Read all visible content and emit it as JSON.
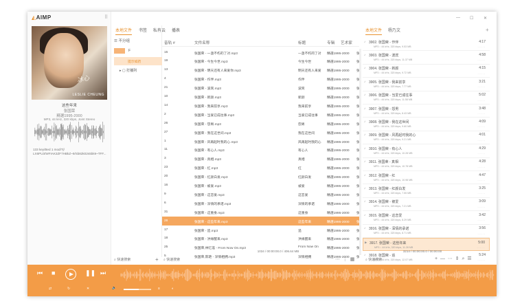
{
  "app": {
    "title": "AIMP"
  },
  "window": {
    "controls": [
      "—",
      "☐",
      "✕"
    ]
  },
  "track_info": {
    "title": "这些年来",
    "artist": "张国荣",
    "album": "精選1995-2000",
    "format": "MP3, 44 kHz, 320 kbps, Joint Stereo",
    "hash_line1": "133 key/Bed 1 mod/?|/",
    "hash_line2": "LX6PU3/WFIAK3ZF7HBkZ~9/Sb82k02s5bk9~TFF..."
  },
  "cover": {
    "signature": "冰心",
    "label": "LESLIE CHEUNG"
  },
  "library": {
    "tabs": [
      "本地文件",
      "书签",
      "私有云",
      "播表"
    ],
    "group_label": "不分组",
    "tree": [
      "F",
      "提示如药",
      "打播列"
    ],
    "search_placeholder": "快速搜索"
  },
  "file_list": {
    "columns": [
      "音轨 #",
      "文件名称",
      "标题",
      "专辑",
      "艺术家"
    ],
    "rows": [
      {
        "track": "15",
        "file": "张国荣 - 一盏不朽的了对.mp3",
        "title": "一盏不朽的了对",
        "album": "精選1995-2000",
        "artist": "张国荣"
      },
      {
        "track": "19",
        "file": "张国荣 - 今生今世.mp3",
        "title": "今生今世",
        "album": "精選1995-2000",
        "artist": "张国荣"
      },
      {
        "track": "13",
        "file": "张国荣 - 明天还有人来爱你.mp3",
        "title": "明天还有人来爱",
        "album": "精選1995-2000",
        "artist": "张国荣"
      },
      {
        "track": "4",
        "file": "张国荣 - 作伴.mp3",
        "title": "作伴",
        "album": "精選1995-2000",
        "artist": "张国荣"
      },
      {
        "track": "21",
        "file": "张国荣 - 波宾.mp3",
        "title": "波宾",
        "album": "精選1995-2000",
        "artist": "张国荣"
      },
      {
        "track": "10",
        "file": "张国荣 - 新颜.mp3",
        "title": "新颜",
        "album": "精選1995-2000",
        "artist": "张国荣"
      },
      {
        "track": "14",
        "file": "张国荣 - 我来前享.mp3",
        "title": "我来前享",
        "album": "精選1995-2000",
        "artist": "张国荣"
      },
      {
        "track": "2",
        "file": "张国荣 - 当爱已成往事.mp3",
        "title": "当爱已成往事",
        "album": "精選1995-2000",
        "artist": "张国荣"
      },
      {
        "track": "26",
        "file": "张国荣 - 怨男.mp3",
        "title": "怨男",
        "album": "精選1995-2000",
        "artist": "张国荣"
      },
      {
        "track": "27",
        "file": "张国荣 - 我在这世间.mp3",
        "title": "我在这世间",
        "album": "精選1995-2000",
        "artist": "张国荣"
      },
      {
        "track": "1",
        "file": "张国荣 - 风再起时我的心.mp3",
        "title": "风再起时我的心",
        "album": "精選1995-2000",
        "artist": "张国荣"
      },
      {
        "track": "11",
        "file": "张国荣 - 有心人.mp3",
        "title": "有心人",
        "album": "精選1995-2000",
        "artist": "张国荣"
      },
      {
        "track": "3",
        "file": "张国荣 - 真相.mp3",
        "title": "真相",
        "album": "精選1995-2000",
        "artist": "张国荣"
      },
      {
        "track": "23",
        "file": "张国荣 - 红.mp3",
        "title": "红",
        "album": "精選1995-2000",
        "artist": "张国荣"
      },
      {
        "track": "20",
        "file": "张国荣 - 红颜白发.mp3",
        "title": "红颜白发",
        "album": "精選1995-2000",
        "artist": "张国荣"
      },
      {
        "track": "16",
        "file": "张国荣 - 被爱.mp3",
        "title": "被爱",
        "album": "精選1995-2000",
        "artist": "张国荣"
      },
      {
        "track": "9",
        "file": "张国荣 - 这恋爱.mp3",
        "title": "这恋爱",
        "album": "精選1995-2000",
        "artist": "张国荣"
      },
      {
        "track": "6",
        "file": "张国荣 - 深情的承诺.mp3",
        "title": "深情的承诺",
        "album": "精選1995-2000",
        "artist": "张国荣"
      },
      {
        "track": "31",
        "file": "张国荣 - 这重身.mp3",
        "title": "这重身",
        "album": "精選1995-2000",
        "artist": "张国荣"
      },
      {
        "track": "28",
        "file": "张国荣 - 这些年来.mp3",
        "title": "这些年来",
        "album": "精選1995-2000",
        "artist": "张国荣",
        "selected": true
      },
      {
        "track": "17",
        "file": "张国荣 - 追.mp3",
        "title": "追",
        "album": "精選1995-2000",
        "artist": "张国荣"
      },
      {
        "track": "18",
        "file": "张国荣 - 洪缘醒来.mp3",
        "title": "洪缘醒来",
        "album": "精選1995-2000",
        "artist": "张国荣"
      },
      {
        "track": "25",
        "file": "张国荣,林忆莲 - From Now On.mp3",
        "title": "From Now On",
        "album": "精選1995-2000",
        "artist": "张国荣,林忆"
      },
      {
        "track": "5",
        "file": "张国荣,陈艳 - 深情相拥.mp3",
        "title": "深情相拥",
        "album": "精選1995-2000",
        "artist": "张国荣,陈艳"
      }
    ],
    "footer": "1034 / 00:00:00.0 / 406.64 MB",
    "search_placeholder": "快速搜索"
  },
  "playlist": {
    "tabs": [
      "本地文件",
      "杨乃文"
    ],
    "items": [
      {
        "title": "3902. 张国荣 - 作伴",
        "info": "MP3 :: 44 kHz, 320 kbps, 9.53 MB",
        "dur": "4:17"
      },
      {
        "title": "3903. 张国荣 - 波宾",
        "info": "MP3 :: 44 kHz, 320 kbps, 11.37 MB",
        "dur": "4:58"
      },
      {
        "title": "3904. 张国荣 - 新颜",
        "info": "MP3 :: 44 kHz, 320 kbps, 9.72 MB",
        "dur": "4:15"
      },
      {
        "title": "3905. 张国荣 - 我来前享",
        "info": "MP3 :: 44 kHz, 320 kbps, 7.77 MB",
        "dur": "3:21"
      },
      {
        "title": "3906. 张国荣 - 当爱已成往事",
        "info": "MP3 :: 44 kHz, 320 kbps, 11.58 MB",
        "dur": "5:02"
      },
      {
        "title": "3907. 张国荣 - 怨男",
        "info": "MP3 :: 44 kHz, 320 kbps, 8.43 MB",
        "dur": "3:48"
      },
      {
        "title": "3908. 张国荣 - 我在这世间",
        "info": "MP3 :: 44 kHz, 320 kbps, 9.60 MB",
        "dur": "4:09"
      },
      {
        "title": "3909. 张国荣 - 风再起时我的心",
        "info": "MP3 :: 44 kHz, 320 kbps, 9.21 MB",
        "dur": "4:01"
      },
      {
        "title": "3910. 张国荣 - 有心人",
        "info": "MP3 :: 44 kHz, 320 kbps, 10.28 MB",
        "dur": "4:29"
      },
      {
        "title": "3911. 张国荣 - 真相",
        "info": "MP3 :: 44 kHz, 320 kbps, 10.78 MB",
        "dur": "4:28"
      },
      {
        "title": "3912. 张国荣 - 红",
        "info": "MP3 :: 44 kHz, 320 kbps, 10.98 MB",
        "dur": "4:47"
      },
      {
        "title": "3913. 张国荣 - 红颜白发",
        "info": "MP3 :: 44 kHz, 320 kbps, 7.55 MB",
        "dur": "3:25"
      },
      {
        "title": "3914. 张国荣 - 被爱",
        "info": "MP3 :: 44 kHz, 320 kbps, 7.21 MB",
        "dur": "3:09"
      },
      {
        "title": "3915. 张国荣 - 这恋爱",
        "info": "MP3 :: 44 kHz, 320 kbps, 8.29 MB",
        "dur": "3:42"
      },
      {
        "title": "3916. 张国荣 - 深情的承诺",
        "info": "MP3 :: 44 kHz, 320 kbps, 8.71 MB",
        "dur": "3:56"
      },
      {
        "title": "3917. 张国荣 - 这些年来",
        "info": "MP3 :: 44 kHz, 320 kbps, 11.28 MB",
        "dur": "5:00",
        "selected": true
      },
      {
        "title": "3918. 张国荣 - 追",
        "info": "MP3 :: 44 kHz, 320 kbps, 12.07 MB",
        "dur": "5:24"
      }
    ],
    "footer": "3214 / 00:00:00.0 / 00:00:00",
    "search_placeholder": "快速搜索"
  },
  "player": {
    "accent": "#f39c47",
    "progress": 0.0,
    "volume": 0.55
  }
}
